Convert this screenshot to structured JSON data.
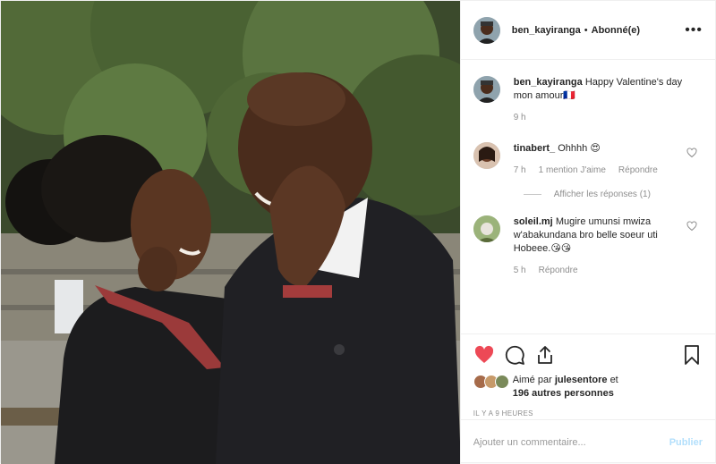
{
  "header": {
    "username": "ben_kayiranga",
    "separator": "•",
    "follow_state": "Abonné(e)",
    "more": "•••"
  },
  "caption": {
    "username": "ben_kayiranga",
    "text": "Happy Valentine's day mon amour",
    "emoji": "🇫🇷",
    "time": "9 h"
  },
  "comments": [
    {
      "username": "tinabert_",
      "text": "Ohhhh",
      "emoji": "😍",
      "time": "7 h",
      "likes": "1 mention J'aime",
      "reply": "Répondre",
      "view_replies": "Afficher les réponses (1)"
    },
    {
      "username": "soleil.mj",
      "text": "Mugire umunsi mwiza w'abakundana bro belle soeur uti Hobeee.",
      "emoji": "😘😘",
      "time": "5 h",
      "reply": "Répondre"
    }
  ],
  "likes": {
    "prefix": "Aimé par",
    "first_user": "julesentore",
    "connector": "et",
    "others": "196 autres personnes"
  },
  "timestamp": "IL Y A 9 HEURES",
  "add_comment": {
    "placeholder": "Ajouter un commentaire...",
    "publish": "Publier"
  },
  "colors": {
    "like_red": "#ed4956",
    "publish_disabled": "#b2dffc",
    "meta_gray": "#8e8e8e"
  },
  "icons": [
    "heart-icon",
    "comment-icon",
    "share-icon",
    "bookmark-icon",
    "more-icon"
  ]
}
